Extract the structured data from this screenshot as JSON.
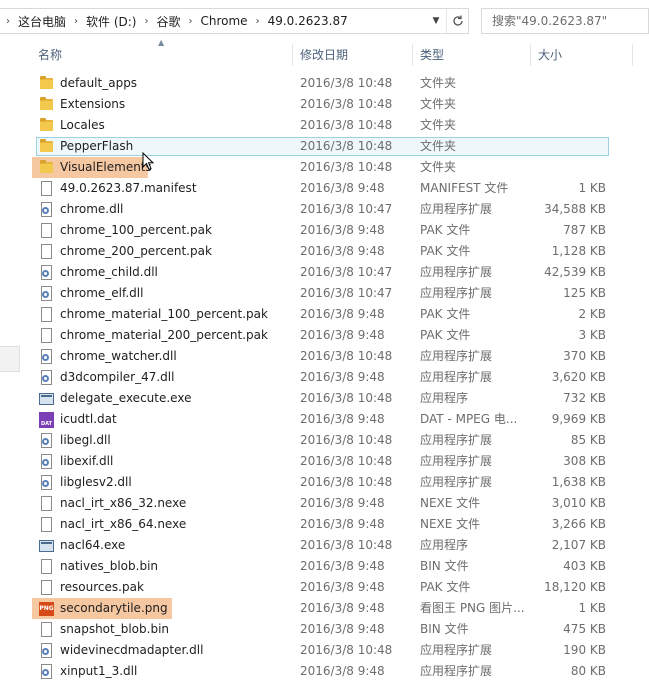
{
  "address": {
    "crumbs": [
      "这台电脑",
      "软件 (D:)",
      "谷歌",
      "Chrome",
      "49.0.2623.87"
    ],
    "search_placeholder": "搜索\"49.0.2623.87\""
  },
  "columns": {
    "name": "名称",
    "date": "修改日期",
    "type": "类型",
    "size": "大小"
  },
  "files": [
    {
      "name": "default_apps",
      "date": "2016/3/8 10:48",
      "type": "文件夹",
      "size": "",
      "icon": "folder-icon"
    },
    {
      "name": "Extensions",
      "date": "2016/3/8 10:48",
      "type": "文件夹",
      "size": "",
      "icon": "folder-icon"
    },
    {
      "name": "Locales",
      "date": "2016/3/8 10:48",
      "type": "文件夹",
      "size": "",
      "icon": "folder-icon"
    },
    {
      "name": "PepperFlash",
      "date": "2016/3/8 10:48",
      "type": "文件夹",
      "size": "",
      "icon": "folder-icon",
      "selected": true
    },
    {
      "name": "VisualElements",
      "date": "2016/3/8 10:48",
      "type": "文件夹",
      "size": "",
      "icon": "folder-icon",
      "highlighted": true
    },
    {
      "name": "49.0.2623.87.manifest",
      "date": "2016/3/8 9:48",
      "type": "MANIFEST 文件",
      "size": "1 KB",
      "icon": "file-icon"
    },
    {
      "name": "chrome.dll",
      "date": "2016/3/8 10:47",
      "type": "应用程序扩展",
      "size": "34,588 KB",
      "icon": "dll-icon"
    },
    {
      "name": "chrome_100_percent.pak",
      "date": "2016/3/8 9:48",
      "type": "PAK 文件",
      "size": "787 KB",
      "icon": "file-icon"
    },
    {
      "name": "chrome_200_percent.pak",
      "date": "2016/3/8 9:48",
      "type": "PAK 文件",
      "size": "1,128 KB",
      "icon": "file-icon"
    },
    {
      "name": "chrome_child.dll",
      "date": "2016/3/8 10:47",
      "type": "应用程序扩展",
      "size": "42,539 KB",
      "icon": "dll-icon"
    },
    {
      "name": "chrome_elf.dll",
      "date": "2016/3/8 10:47",
      "type": "应用程序扩展",
      "size": "125 KB",
      "icon": "dll-icon"
    },
    {
      "name": "chrome_material_100_percent.pak",
      "date": "2016/3/8 9:48",
      "type": "PAK 文件",
      "size": "2 KB",
      "icon": "file-icon"
    },
    {
      "name": "chrome_material_200_percent.pak",
      "date": "2016/3/8 9:48",
      "type": "PAK 文件",
      "size": "3 KB",
      "icon": "file-icon"
    },
    {
      "name": "chrome_watcher.dll",
      "date": "2016/3/8 10:48",
      "type": "应用程序扩展",
      "size": "370 KB",
      "icon": "dll-icon"
    },
    {
      "name": "d3dcompiler_47.dll",
      "date": "2016/3/8 9:48",
      "type": "应用程序扩展",
      "size": "3,620 KB",
      "icon": "dll-icon"
    },
    {
      "name": "delegate_execute.exe",
      "date": "2016/3/8 10:48",
      "type": "应用程序",
      "size": "732 KB",
      "icon": "exe-icon"
    },
    {
      "name": "icudtl.dat",
      "date": "2016/3/8 9:48",
      "type": "DAT - MPEG 电...",
      "size": "9,969 KB",
      "icon": "dat-icon"
    },
    {
      "name": "libegl.dll",
      "date": "2016/3/8 10:48",
      "type": "应用程序扩展",
      "size": "85 KB",
      "icon": "dll-icon"
    },
    {
      "name": "libexif.dll",
      "date": "2016/3/8 10:48",
      "type": "应用程序扩展",
      "size": "308 KB",
      "icon": "dll-icon"
    },
    {
      "name": "libglesv2.dll",
      "date": "2016/3/8 10:48",
      "type": "应用程序扩展",
      "size": "1,638 KB",
      "icon": "dll-icon"
    },
    {
      "name": "nacl_irt_x86_32.nexe",
      "date": "2016/3/8 9:48",
      "type": "NEXE 文件",
      "size": "3,010 KB",
      "icon": "file-icon"
    },
    {
      "name": "nacl_irt_x86_64.nexe",
      "date": "2016/3/8 9:48",
      "type": "NEXE 文件",
      "size": "3,266 KB",
      "icon": "file-icon"
    },
    {
      "name": "nacl64.exe",
      "date": "2016/3/8 10:48",
      "type": "应用程序",
      "size": "2,107 KB",
      "icon": "exe-icon"
    },
    {
      "name": "natives_blob.bin",
      "date": "2016/3/8 9:48",
      "type": "BIN 文件",
      "size": "403 KB",
      "icon": "file-icon"
    },
    {
      "name": "resources.pak",
      "date": "2016/3/8 9:48",
      "type": "PAK 文件",
      "size": "18,120 KB",
      "icon": "file-icon"
    },
    {
      "name": "secondarytile.png",
      "date": "2016/3/8 9:48",
      "type": "看图王 PNG 图片...",
      "size": "1 KB",
      "icon": "png-icon",
      "highlighted": true
    },
    {
      "name": "snapshot_blob.bin",
      "date": "2016/3/8 9:48",
      "type": "BIN 文件",
      "size": "475 KB",
      "icon": "file-icon"
    },
    {
      "name": "widevinecdmadapter.dll",
      "date": "2016/3/8 10:48",
      "type": "应用程序扩展",
      "size": "190 KB",
      "icon": "dll-icon"
    },
    {
      "name": "xinput1_3.dll",
      "date": "2016/3/8 9:48",
      "type": "应用程序扩展",
      "size": "80 KB",
      "icon": "dll-icon"
    }
  ],
  "colors": {
    "folder": "#f2c94c",
    "selection_border": "#9cd2e0",
    "highlight": "#f6c8a2",
    "header_text": "#4c607a"
  }
}
